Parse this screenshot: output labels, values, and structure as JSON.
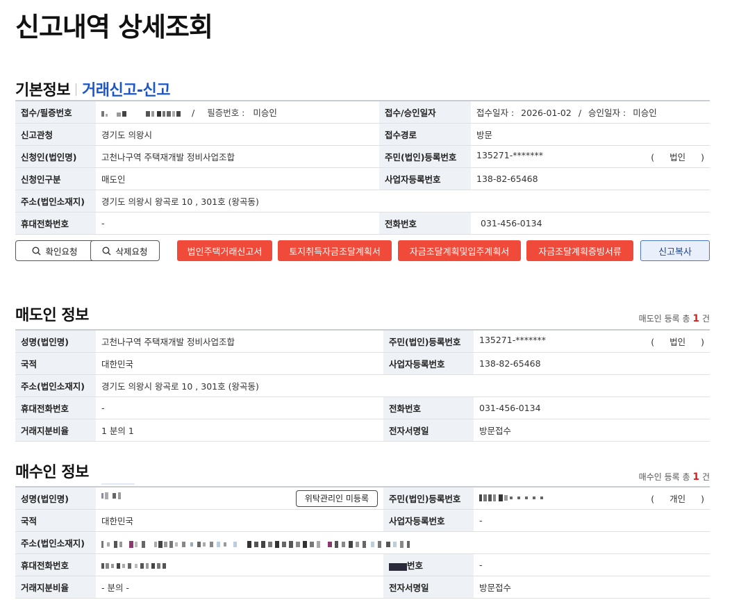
{
  "page": {
    "title": "신고내역 상세조회"
  },
  "basic": {
    "title": "기본정보",
    "subtitle": "거래신고-신고",
    "rows": {
      "receipt_label": "접수/필증번호",
      "receipt_sep": "/",
      "cert_label": "필증번호 :",
      "cert_value": "미승인",
      "approve_label": "접수/승인일자",
      "receipt_date_label": "접수일자 :",
      "receipt_date": "2026-01-02",
      "date_sep": "/",
      "approve_date_label": "승인일자 :",
      "approve_date": "미승인",
      "office_label": "신고관청",
      "office_value": "경기도 의왕시",
      "route_label": "접수경로",
      "route_value": "방문",
      "applicant_label": "신청인(법인명)",
      "applicant_value": "고천나구역 주택재개발 정비사업조합",
      "regno_label": "주민(법인)등록번호",
      "regno_value": "135271-*******",
      "regno_type": "법인",
      "regno_open": "(",
      "regno_close": ")",
      "type_label": "신청인구분",
      "type_value": "매도인",
      "bizno_label": "사업자등록번호",
      "bizno_value": "138-82-65468",
      "addr_label": "주소(법인소재지)",
      "addr_value": "경기도 의왕시 왕곡로 10 , 301호  (왕곡동)",
      "mobile_label": "휴대전화번호",
      "mobile_value": "-",
      "phone_label": "전화번호",
      "phone_value": "031-456-0134"
    }
  },
  "actions": {
    "confirm": "확인요청",
    "delete": "삭제요청",
    "doc1": "법인주택거래신고서",
    "doc2": "토지취득자금조달계획서",
    "doc3": "자금조달계획및입주계획서",
    "doc4": "자금조달계획증빙서류",
    "copy": "신고복사"
  },
  "seller": {
    "title": "매도인 정보",
    "count_prefix": "매도인 등록 총",
    "count": "1",
    "count_suffix": "건",
    "name_label": "성명(법인명)",
    "name_value": "고천나구역 주택재개발 정비사업조합",
    "regno_label": "주민(법인)등록번호",
    "regno_value": "135271-*******",
    "regno_type": "법인",
    "regno_open": "(",
    "regno_close": ")",
    "nation_label": "국적",
    "nation_value": "대한민국",
    "bizno_label": "사업자등록번호",
    "bizno_value": "138-82-65468",
    "addr_label": "주소(법인소재지)",
    "addr_value": "경기도 의왕시 왕곡로 10 , 301호  (왕곡동)",
    "mobile_label": "휴대전화번호",
    "mobile_value": "-",
    "phone_label": "전화번호",
    "phone_value": "031-456-0134",
    "share_label": "거래지분비율",
    "share_value": "1 분의 1",
    "sign_label": "전자서명일",
    "sign_value": "방문접수"
  },
  "buyer": {
    "title": "매수인 정보",
    "count_prefix": "매수인 등록 총",
    "count": "1",
    "count_suffix": "건",
    "name_label": "성명(법인명)",
    "trust_button": "위탁관리인 미등록",
    "regno_label": "주민(법인)등록번호",
    "regno_type": "개인",
    "regno_open": "(",
    "regno_close": ")",
    "nation_label": "국적",
    "nation_value": "대한민국",
    "bizno_label": "사업자등록번호",
    "bizno_value": "-",
    "addr_label": "주소(법인소재지)",
    "mobile_label": "휴대전화번호",
    "phone_label_tail": "번호",
    "phone_value": "-",
    "share_label": "거래지분비율",
    "share_value": "- 분의 -",
    "sign_label": "전자서명일",
    "sign_value": "방문접수"
  }
}
